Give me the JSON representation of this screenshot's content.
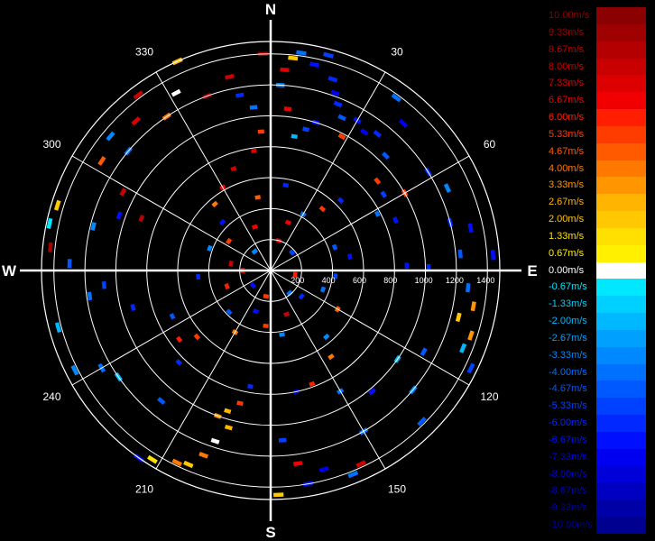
{
  "chart_data": {
    "type": "polar-radial-velocity",
    "cardinal_labels": [
      {
        "text": "N",
        "angle": 0
      },
      {
        "text": "E",
        "angle": 90
      },
      {
        "text": "S",
        "angle": 180
      },
      {
        "text": "W",
        "angle": 270
      }
    ],
    "angle_labels": [
      {
        "text": "30",
        "angle": 30
      },
      {
        "text": "60",
        "angle": 60
      },
      {
        "text": "120",
        "angle": 120
      },
      {
        "text": "150",
        "angle": 150
      },
      {
        "text": "210",
        "angle": 210
      },
      {
        "text": "240",
        "angle": 240
      },
      {
        "text": "300",
        "angle": 300
      },
      {
        "text": "330",
        "angle": 330
      }
    ],
    "range_labels": [
      "200",
      "400",
      "600",
      "800",
      "1000",
      "1200",
      "1400"
    ],
    "range_rings": [
      200,
      400,
      600,
      800,
      1000,
      1200,
      1400
    ],
    "range_max": 1480,
    "legend": [
      {
        "label": "10.00m/s",
        "color": "#8b0000"
      },
      {
        "label": "9.33m/s",
        "color": "#9f0000"
      },
      {
        "label": "8.67m/s",
        "color": "#b40000"
      },
      {
        "label": "8.00m/s",
        "color": "#c80000"
      },
      {
        "label": "7.33m/s",
        "color": "#dc0000"
      },
      {
        "label": "6.67m/s",
        "color": "#f00000"
      },
      {
        "label": "6.00m/s",
        "color": "#ff1e00"
      },
      {
        "label": "5.33m/s",
        "color": "#ff3c00"
      },
      {
        "label": "4.67m/s",
        "color": "#ff5a00"
      },
      {
        "label": "4.00m/s",
        "color": "#ff7800"
      },
      {
        "label": "3.33m/s",
        "color": "#ff9600"
      },
      {
        "label": "2.67m/s",
        "color": "#ffb400"
      },
      {
        "label": "2.00m/s",
        "color": "#ffc800"
      },
      {
        "label": "1.33m/s",
        "color": "#ffe000"
      },
      {
        "label": "0.67m/s",
        "color": "#fff000"
      },
      {
        "label": "0.00m/s",
        "color": "#ffffff"
      },
      {
        "label": "-0.67m/s",
        "color": "#00e8ff"
      },
      {
        "label": "-1.33m/s",
        "color": "#00d0ff"
      },
      {
        "label": "-2.00m/s",
        "color": "#00b8ff"
      },
      {
        "label": "-2.67m/s",
        "color": "#00a0ff"
      },
      {
        "label": "-3.33m/s",
        "color": "#0088ff"
      },
      {
        "label": "-4.00m/s",
        "color": "#0070ff"
      },
      {
        "label": "-4.67m/s",
        "color": "#0058ff"
      },
      {
        "label": "-5.33m/s",
        "color": "#0040ff"
      },
      {
        "label": "-6.00m/s",
        "color": "#0028ff"
      },
      {
        "label": "-6.67m/s",
        "color": "#0010ff"
      },
      {
        "label": "-7.33m/s",
        "color": "#0000f0"
      },
      {
        "label": "-8.00m/s",
        "color": "#0000d8"
      },
      {
        "label": "-8.67m/s",
        "color": "#0000c0"
      },
      {
        "label": "-9.33m/s",
        "color": "#0000a8"
      },
      {
        "label": "-10.00m/s",
        "color": "#000090"
      }
    ],
    "returns": [
      {
        "az": 4,
        "r": 1300,
        "v": 7.3
      },
      {
        "az": 358,
        "r": 1400,
        "v": 9.3
      },
      {
        "az": 6,
        "r": 1380,
        "v": 2.0
      },
      {
        "az": 8,
        "r": 1420,
        "v": -4.0
      },
      {
        "az": 12,
        "r": 1360,
        "v": -6.7
      },
      {
        "az": 15,
        "r": 1440,
        "v": -5.3
      },
      {
        "az": 18,
        "r": 1300,
        "v": -6.0
      },
      {
        "az": 20,
        "r": 1220,
        "v": -7.3
      },
      {
        "az": 22,
        "r": 1160,
        "v": -6.0
      },
      {
        "az": 25,
        "r": 1090,
        "v": -4.7
      },
      {
        "az": 17,
        "r": 1000,
        "v": -6.7
      },
      {
        "az": 14,
        "r": 940,
        "v": -5.3
      },
      {
        "az": 10,
        "r": 880,
        "v": -2.0
      },
      {
        "az": 6,
        "r": 1050,
        "v": 6.7
      },
      {
        "az": 3,
        "r": 1200,
        "v": -3.3
      },
      {
        "az": 28,
        "r": 980,
        "v": 5.3
      },
      {
        "az": 30,
        "r": 1120,
        "v": -6.7
      },
      {
        "az": 34,
        "r": 1080,
        "v": -7.3
      },
      {
        "az": 38,
        "r": 1120,
        "v": -6.0
      },
      {
        "az": 45,
        "r": 1050,
        "v": -4.7
      },
      {
        "az": 50,
        "r": 900,
        "v": 5.3
      },
      {
        "az": 56,
        "r": 880,
        "v": -5.3
      },
      {
        "az": 62,
        "r": 780,
        "v": -4.0
      },
      {
        "az": 68,
        "r": 870,
        "v": -6.7
      },
      {
        "az": 75,
        "r": 1200,
        "v": -6.0
      },
      {
        "az": 78,
        "r": 1320,
        "v": -6.7
      },
      {
        "az": 85,
        "r": 1230,
        "v": -4.7
      },
      {
        "az": 88,
        "r": 880,
        "v": -6.7
      },
      {
        "az": 89,
        "r": 1020,
        "v": -6.0
      },
      {
        "az": 95,
        "r": 1280,
        "v": -4.0
      },
      {
        "az": 100,
        "r": 1330,
        "v": 3.3
      },
      {
        "az": 104,
        "r": 1250,
        "v": 2.0
      },
      {
        "az": 108,
        "r": 1360,
        "v": 3.3
      },
      {
        "az": 112,
        "r": 1340,
        "v": -2.0
      },
      {
        "az": 116,
        "r": 1440,
        "v": -5.3
      },
      {
        "az": 118,
        "r": 1120,
        "v": -4.7
      },
      {
        "az": 125,
        "r": 1000,
        "v": -2.0
      },
      {
        "az": 130,
        "r": 1200,
        "v": -3.3
      },
      {
        "az": 135,
        "r": 1380,
        "v": -4.7
      },
      {
        "az": 140,
        "r": 1020,
        "v": -6.7
      },
      {
        "az": 150,
        "r": 1200,
        "v": -4.0
      },
      {
        "az": 155,
        "r": 1380,
        "v": 8.0
      },
      {
        "az": 158,
        "r": 1420,
        "v": -4.0
      },
      {
        "az": 165,
        "r": 1330,
        "v": -7.3
      },
      {
        "az": 170,
        "r": 1400,
        "v": -6.7
      },
      {
        "az": 172,
        "r": 1260,
        "v": 6.7
      },
      {
        "az": 176,
        "r": 1100,
        "v": -5.3
      },
      {
        "az": 178,
        "r": 1450,
        "v": 2.0
      },
      {
        "az": 168,
        "r": 800,
        "v": -7.3
      },
      {
        "az": 160,
        "r": 780,
        "v": 6.0
      },
      {
        "az": 150,
        "r": 900,
        "v": -4.0
      },
      {
        "az": 145,
        "r": 680,
        "v": 4.0
      },
      {
        "az": 140,
        "r": 560,
        "v": -3.3
      },
      {
        "az": 195,
        "r": 1050,
        "v": 2.67
      },
      {
        "az": 198,
        "r": 1160,
        "v": 0.2
      },
      {
        "az": 200,
        "r": 1270,
        "v": 4.0
      },
      {
        "az": 203,
        "r": 1360,
        "v": 2.0
      },
      {
        "az": 206,
        "r": 1380,
        "v": 4.0
      },
      {
        "az": 200,
        "r": 1000,
        "v": 3.33
      },
      {
        "az": 197,
        "r": 950,
        "v": 2.67
      },
      {
        "az": 193,
        "r": 880,
        "v": 5.3
      },
      {
        "az": 190,
        "r": 760,
        "v": -6.0
      },
      {
        "az": 212,
        "r": 1440,
        "v": 1.33
      },
      {
        "az": 215,
        "r": 1480,
        "v": -6.7
      },
      {
        "az": 220,
        "r": 1100,
        "v": -4.7
      },
      {
        "az": 225,
        "r": 840,
        "v": -6.0
      },
      {
        "az": 235,
        "r": 1200,
        "v": -2.0
      },
      {
        "az": 240,
        "r": 1260,
        "v": -4.0
      },
      {
        "az": 243,
        "r": 1420,
        "v": -3.3
      },
      {
        "az": 233,
        "r": 740,
        "v": 6.0
      },
      {
        "az": 228,
        "r": 640,
        "v": 5.3
      },
      {
        "az": 245,
        "r": 700,
        "v": -4.7
      },
      {
        "az": 255,
        "r": 920,
        "v": -6.0
      },
      {
        "az": 262,
        "r": 1180,
        "v": -4.0
      },
      {
        "az": 255,
        "r": 1420,
        "v": -2.0
      },
      {
        "az": 265,
        "r": 1080,
        "v": -5.3
      },
      {
        "az": 272,
        "r": 1300,
        "v": -4.7
      },
      {
        "az": 276,
        "r": 1430,
        "v": 9.3
      },
      {
        "az": 282,
        "r": 1460,
        "v": -0.5
      },
      {
        "az": 287,
        "r": 1440,
        "v": 2.0
      },
      {
        "az": 284,
        "r": 1180,
        "v": -3.3
      },
      {
        "az": 290,
        "r": 1040,
        "v": -6.7
      },
      {
        "az": 292,
        "r": 900,
        "v": 8.67
      },
      {
        "az": 298,
        "r": 1080,
        "v": 8.0
      },
      {
        "az": 303,
        "r": 1300,
        "v": 4.7
      },
      {
        "az": 310,
        "r": 1200,
        "v": -4.0
      },
      {
        "az": 310,
        "r": 1350,
        "v": -3.3
      },
      {
        "az": 318,
        "r": 1300,
        "v": 7.3
      },
      {
        "az": 323,
        "r": 1420,
        "v": 8.0
      },
      {
        "az": 326,
        "r": 1200,
        "v": 4.0
      },
      {
        "az": 332,
        "r": 1300,
        "v": 0.2
      },
      {
        "az": 336,
        "r": 1480,
        "v": 2.67
      },
      {
        "az": 340,
        "r": 1200,
        "v": 9.33
      },
      {
        "az": 348,
        "r": 1280,
        "v": 8.0
      },
      {
        "az": 350,
        "r": 1150,
        "v": -6.0
      },
      {
        "az": 354,
        "r": 1060,
        "v": -4.0
      },
      {
        "az": 356,
        "r": 900,
        "v": 5.33
      },
      {
        "az": 352,
        "r": 780,
        "v": 7.3
      },
      {
        "az": 340,
        "r": 700,
        "v": 8.0
      },
      {
        "az": 330,
        "r": 620,
        "v": 6.7
      },
      {
        "az": 320,
        "r": 560,
        "v": 4.0
      },
      {
        "az": 45,
        "r": 640,
        "v": -6.0
      },
      {
        "az": 40,
        "r": 520,
        "v": 5.3
      },
      {
        "az": 30,
        "r": 420,
        "v": -4.0
      },
      {
        "az": 20,
        "r": 330,
        "v": 6.7
      },
      {
        "az": 70,
        "r": 440,
        "v": -4.7
      },
      {
        "az": 80,
        "r": 520,
        "v": -6.7
      },
      {
        "az": 95,
        "r": 420,
        "v": -5.3
      },
      {
        "az": 110,
        "r": 360,
        "v": -4.0
      },
      {
        "az": 120,
        "r": 500,
        "v": 4.7
      },
      {
        "az": 130,
        "r": 260,
        "v": -6.0
      },
      {
        "az": 160,
        "r": 300,
        "v": 8.0
      },
      {
        "az": 170,
        "r": 420,
        "v": -3.3
      },
      {
        "az": 185,
        "r": 360,
        "v": 5.3
      },
      {
        "az": 200,
        "r": 280,
        "v": -6.7
      },
      {
        "az": 210,
        "r": 460,
        "v": 4.0
      },
      {
        "az": 225,
        "r": 380,
        "v": -4.7
      },
      {
        "az": 250,
        "r": 300,
        "v": 6.0
      },
      {
        "az": 265,
        "r": 470,
        "v": -6.0
      },
      {
        "az": 280,
        "r": 260,
        "v": 8.0
      },
      {
        "az": 290,
        "r": 420,
        "v": -3.3
      },
      {
        "az": 305,
        "r": 330,
        "v": 5.3
      },
      {
        "az": 315,
        "r": 440,
        "v": -6.7
      },
      {
        "az": 340,
        "r": 300,
        "v": 6.7
      },
      {
        "az": 350,
        "r": 480,
        "v": 4.7
      },
      {
        "az": 10,
        "r": 560,
        "v": -6.0
      },
      {
        "az": 15,
        "r": 200,
        "v": 7.3
      },
      {
        "az": 50,
        "r": 180,
        "v": -5.3
      },
      {
        "az": 100,
        "r": 160,
        "v": 6.0
      },
      {
        "az": 140,
        "r": 190,
        "v": -4.0
      },
      {
        "az": 190,
        "r": 170,
        "v": 5.3
      },
      {
        "az": 230,
        "r": 150,
        "v": -6.7
      },
      {
        "az": 270,
        "r": 180,
        "v": 8.0
      },
      {
        "az": 320,
        "r": 160,
        "v": -3.3
      },
      {
        "az": 60,
        "r": 1000,
        "v": 5.3
      },
      {
        "az": 58,
        "r": 1200,
        "v": -6.0
      },
      {
        "az": 65,
        "r": 1260,
        "v": -3.3
      },
      {
        "az": 42,
        "r": 1280,
        "v": -7.3
      },
      {
        "az": 36,
        "r": 1380,
        "v": -4.0
      },
      {
        "az": 86,
        "r": 1440,
        "v": -6.7
      }
    ]
  }
}
